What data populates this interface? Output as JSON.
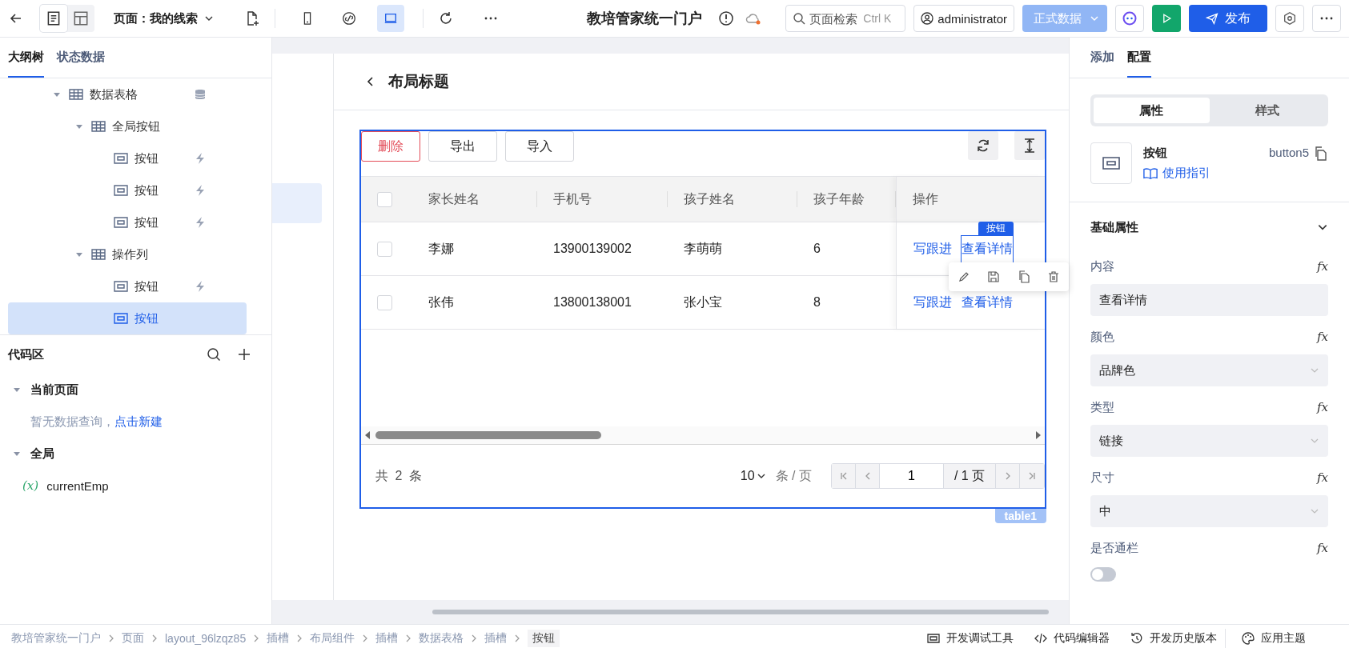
{
  "toolbar": {
    "view_modes": [
      {
        "selected": true
      },
      {
        "selected": false
      }
    ],
    "page_label": "页面：我的线索",
    "devices": [
      {
        "kind": "phone",
        "selected": false
      },
      {
        "kind": "link",
        "selected": false
      },
      {
        "kind": "desktop",
        "selected": true
      }
    ],
    "app_title": "教培管家统一门户",
    "search": {
      "placeholder": "页面检索",
      "shortcut": "Ctrl K"
    },
    "user": "administrator",
    "env": "正式数据",
    "publish": "发布"
  },
  "left_panel": {
    "tabs": [
      {
        "label": "大纲树",
        "selected": true
      },
      {
        "label": "状态数据",
        "selected": false
      }
    ],
    "tree": [
      {
        "label": "数据表格",
        "kind": "table",
        "has_data_source": true,
        "selected": false,
        "expanded": true,
        "children": [
          {
            "label": "全局按钮",
            "kind": "table",
            "selected": false,
            "expanded": true,
            "children": [
              {
                "label": "按钮",
                "kind": "button",
                "has_event": true,
                "selected": false
              },
              {
                "label": "按钮",
                "kind": "button",
                "has_event": true,
                "selected": false
              },
              {
                "label": "按钮",
                "kind": "button",
                "has_event": true,
                "selected": false
              }
            ]
          },
          {
            "label": "操作列",
            "kind": "table",
            "selected": false,
            "expanded": true,
            "children": [
              {
                "label": "按钮",
                "kind": "button",
                "has_event": true,
                "selected": false
              },
              {
                "label": "按钮",
                "kind": "button",
                "selected": true
              }
            ]
          }
        ]
      }
    ],
    "code_area": {
      "title": "代码区",
      "groups": [
        {
          "label": "当前页面",
          "expanded": true,
          "empty_text": "暂无数据查询，",
          "empty_link": "点击新建"
        },
        {
          "label": "全局",
          "expanded": true,
          "variables": [
            {
              "icon": "(x)",
              "name": "currentEmp"
            }
          ]
        }
      ]
    }
  },
  "canvas": {
    "page_title": "布局标题",
    "table": {
      "toolbar_buttons": [
        {
          "label": "删除",
          "kind": "danger"
        },
        {
          "label": "导出",
          "kind": "default"
        },
        {
          "label": "导入",
          "kind": "default"
        }
      ],
      "header_checked": false,
      "columns": [
        "家长姓名",
        "手机号",
        "孩子姓名",
        "孩子年龄",
        "操作"
      ],
      "rows": [
        {
          "checked": false,
          "cells": [
            "李娜",
            "13900139002",
            "李萌萌",
            "6"
          ],
          "actions": [
            {
              "label": "写跟进",
              "selected": false
            },
            {
              "label": "查看详情",
              "selected": true
            }
          ]
        },
        {
          "checked": false,
          "cells": [
            "张伟",
            "13800138001",
            "张小宝",
            "8"
          ],
          "actions": [
            {
              "label": "写跟进",
              "selected": false
            },
            {
              "label": "查看详情",
              "selected": false
            }
          ]
        }
      ],
      "selection_badge": "按钮",
      "footer": {
        "total": "共 2 条",
        "page_size": "10",
        "per_page": "条 / 页",
        "page": "1",
        "total_pages": "/ 1 页"
      },
      "name_tag": "table1"
    }
  },
  "right_panel": {
    "tabs": [
      {
        "label": "添加",
        "selected": false
      },
      {
        "label": "配置",
        "selected": true
      }
    ],
    "segments": [
      {
        "label": "属性",
        "selected": true
      },
      {
        "label": "样式",
        "selected": false
      }
    ],
    "component": {
      "name": "按钮",
      "id": "button5",
      "guide": "使用指引"
    },
    "section": {
      "title": "基础属性",
      "expanded": true
    },
    "props": [
      {
        "label": "内容",
        "formula": "fx",
        "kind": "text",
        "value": "查看详情"
      },
      {
        "label": "颜色",
        "formula": "fx",
        "kind": "select",
        "value": "品牌色"
      },
      {
        "label": "类型",
        "formula": "fx",
        "kind": "select",
        "value": "链接"
      },
      {
        "label": "尺寸",
        "formula": "fx",
        "kind": "select",
        "value": "中"
      },
      {
        "label": "是否通栏",
        "formula": "fx",
        "kind": "switch",
        "on": false
      }
    ]
  },
  "status_bar": {
    "breadcrumb": [
      "教培管家统一门户",
      "页面",
      "layout_96lzqz85",
      "插槽",
      "布局组件",
      "插槽",
      "数据表格",
      "插槽",
      "按钮"
    ],
    "tools": [
      {
        "kind": "debug",
        "label": "开发调试工具"
      },
      {
        "kind": "code",
        "label": "代码编辑器"
      },
      {
        "kind": "history",
        "label": "开发历史版本"
      }
    ],
    "theme": "应用主题"
  }
}
